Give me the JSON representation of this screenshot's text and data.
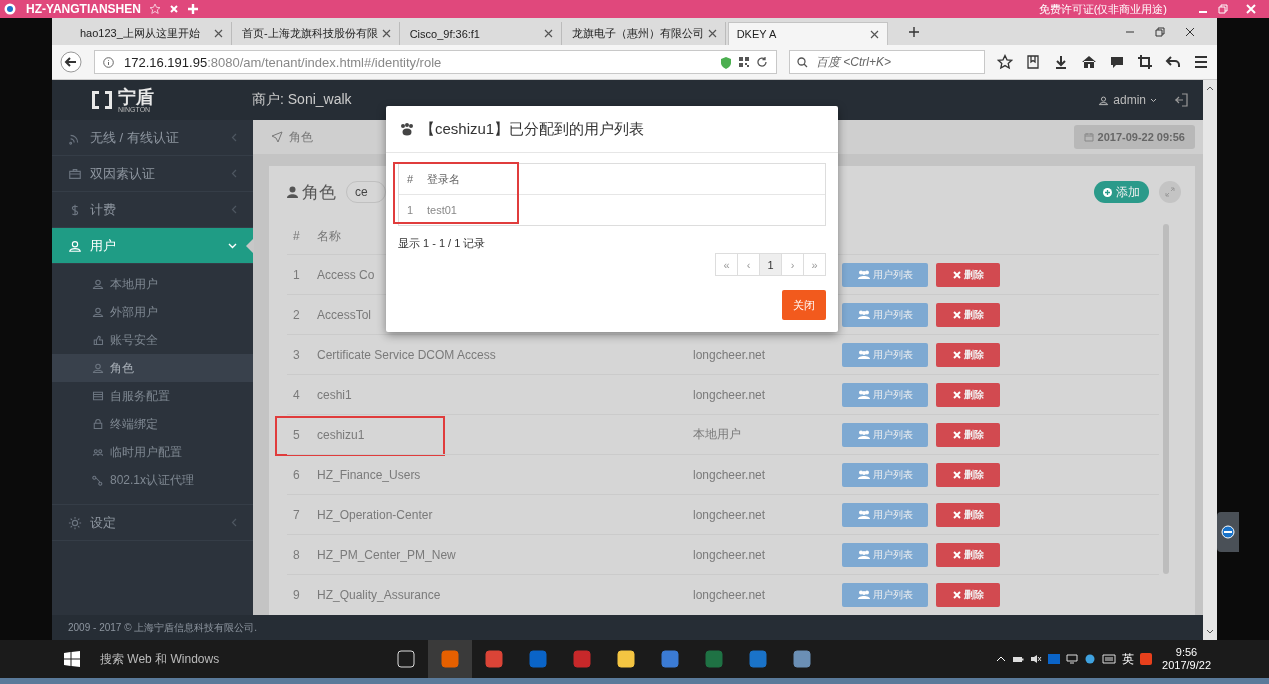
{
  "remote_bar": {
    "title": "HZ-YANGTIANSHEN",
    "license": "免费许可证(仅非商业用途)"
  },
  "browser": {
    "tabs": [
      {
        "label": "hao123_上网从这里开始",
        "selected": false
      },
      {
        "label": "首页-上海龙旗科技股份有限",
        "selected": false
      },
      {
        "label": "Cisco_9f:36:f1",
        "selected": false
      },
      {
        "label": "龙旗电子（惠州）有限公司",
        "selected": false
      },
      {
        "label": "DKEY A",
        "selected": true
      }
    ],
    "url_host": "172.16.191.95",
    "url_rest": ":8080/am/tenant/index.html#/identity/role",
    "search_placeholder": "百度 <Ctrl+K>"
  },
  "header": {
    "brand": "宁盾",
    "brand_sub": "NINGTON",
    "tenant": "商户: Soni_walk",
    "user": "admin"
  },
  "sidebar": {
    "items": [
      {
        "label": "无线 / 有线认证",
        "selected": false,
        "expanded": false
      },
      {
        "label": "双因素认证",
        "selected": false,
        "expanded": false
      },
      {
        "label": "计费",
        "selected": false,
        "expanded": false
      },
      {
        "label": "用户",
        "selected": true,
        "expanded": true,
        "children": [
          {
            "label": "本地用户",
            "selected": false
          },
          {
            "label": "外部用户",
            "selected": false
          },
          {
            "label": "账号安全",
            "selected": false
          },
          {
            "label": "角色",
            "selected": true
          },
          {
            "label": "自服务配置",
            "selected": false
          },
          {
            "label": "终端绑定",
            "selected": false
          },
          {
            "label": "临时用户配置",
            "selected": false
          },
          {
            "label": "802.1x认证代理",
            "selected": false
          }
        ]
      },
      {
        "label": "设定",
        "selected": false,
        "expanded": false
      }
    ]
  },
  "breadcrumb": "角色",
  "date": "2017-09-22 09:56",
  "card": {
    "title": "角色",
    "search_value": "ce",
    "add_button": "添加"
  },
  "table": {
    "columns": [
      "#",
      "名称"
    ],
    "rows": [
      {
        "index": "1",
        "name": "Access Co",
        "actions": [
          "用户列表",
          "删除"
        ],
        "highlighted": false
      },
      {
        "index": "2",
        "name": "AccessTol",
        "actions": [
          "用户列表",
          "删除"
        ],
        "highlighted": false
      },
      {
        "index": "3",
        "name": "Certificate Service DCOM Access",
        "domain": "longcheer.net",
        "actions": [
          "用户列表",
          "删除"
        ],
        "highlighted": false
      },
      {
        "index": "4",
        "name": "ceshi1",
        "domain": "longcheer.net",
        "actions": [
          "用户列表",
          "删除"
        ],
        "highlighted": false
      },
      {
        "index": "5",
        "name": "ceshizu1",
        "domain": "本地用户",
        "actions": [
          "用户列表",
          "删除"
        ],
        "highlighted": true
      },
      {
        "index": "6",
        "name": "HZ_Finance_Users",
        "domain": "longcheer.net",
        "actions": [
          "用户列表",
          "删除"
        ],
        "highlighted": false
      },
      {
        "index": "7",
        "name": "HZ_Operation-Center",
        "domain": "longcheer.net",
        "actions": [
          "用户列表",
          "删除"
        ],
        "highlighted": false
      },
      {
        "index": "8",
        "name": "HZ_PM_Center_PM_New",
        "domain": "longcheer.net",
        "actions": [
          "用户列表",
          "删除"
        ],
        "highlighted": false
      },
      {
        "index": "9",
        "name": "HZ_Quality_Assurance",
        "domain": "longcheer.net",
        "actions": [
          "用户列表",
          "删除"
        ],
        "highlighted": false
      }
    ]
  },
  "modal": {
    "title": "【ceshizu1】已分配到的用户列表",
    "columns": [
      "#",
      "登录名"
    ],
    "rows": [
      [
        "1",
        "test01"
      ]
    ],
    "highlighted": true,
    "summary": "显示 1 - 1 / 1 记录",
    "pages": [
      {
        "label": "«",
        "selected": false
      },
      {
        "label": "‹",
        "selected": false
      },
      {
        "label": "1",
        "selected": true
      },
      {
        "label": "›",
        "selected": false
      },
      {
        "label": "»",
        "selected": false
      }
    ],
    "close_button": "关闭"
  },
  "footer": "2009 - 2017 © 上海宁盾信息科技有限公司.",
  "taskbar": {
    "search": "搜索 Web 和 Windows",
    "language": "英",
    "time": "9:56",
    "date": "2017/9/22"
  }
}
